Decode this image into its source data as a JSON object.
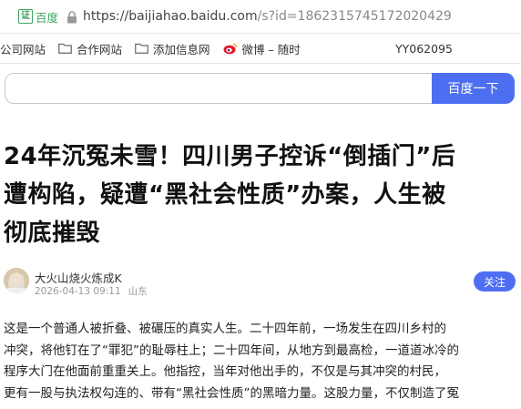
{
  "browser": {
    "badge_char": "证",
    "badge_label": "百度",
    "url_host": "https://baijiahao.baidu.com",
    "url_rest": "/s?id=1862315745172020429"
  },
  "bookmarks": {
    "items": [
      {
        "label": "公司网站",
        "icon": "folder-icon"
      },
      {
        "label": "合作网站",
        "icon": "folder-icon"
      },
      {
        "label": "添加信息网",
        "icon": "folder-icon"
      },
      {
        "label": "微博 – 随时",
        "icon": "weibo-icon"
      }
    ],
    "code": "YY062095"
  },
  "search": {
    "value": "",
    "button_label": "百度一下"
  },
  "article": {
    "title_lines": [
      "24年沉冤未雪！四川男子控诉“倒插门”后",
      "遭构陷，疑遭“黑社会性质”办案，人生被",
      "彻底摧毁"
    ],
    "author": {
      "name": "大火山烧火炼成K",
      "date": "2026-04-13 09:11",
      "location": "山东",
      "follow_label": "关注"
    },
    "body_lines": [
      " 这是一个普通人被折叠、被碾压的真实人生。二十四年前，一场发生在四川乡村的",
      "冲突，将他钉在了“罪犯”的耻辱柱上；二十四年间，从地方到最高检，一道道冰冷的",
      " 程序大门在他面前重重关上。他指控，当年对他出手的，不仅是与其冲突的村民，",
      "更有一股与执法权勾连的、带有“黑社会性质”的黑暗力量。这股力量，不仅制造了冤"
    ]
  },
  "colors": {
    "accent": "#4e6ef2",
    "secure_green": "#3ba55d"
  }
}
